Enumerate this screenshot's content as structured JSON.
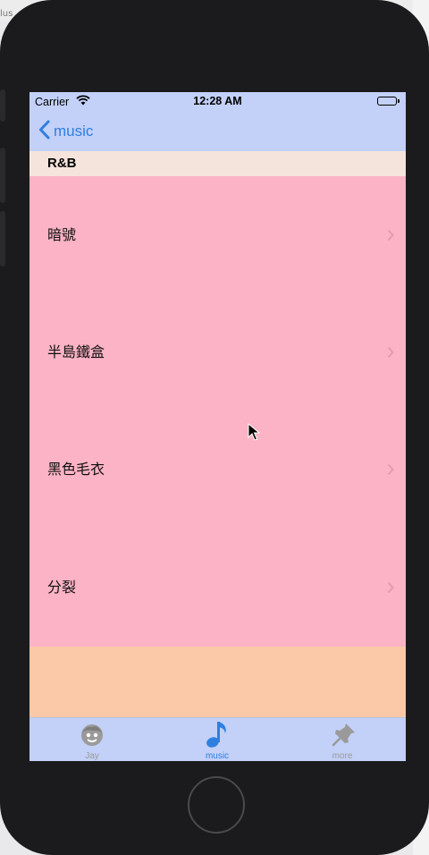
{
  "background": {
    "window_label": "lus"
  },
  "status_bar": {
    "carrier": "Carrier",
    "time": "12:28 AM"
  },
  "nav_bar": {
    "back_label": "music"
  },
  "section": {
    "header": "R&B"
  },
  "rows": [
    {
      "title": "暗號"
    },
    {
      "title": "半島鐵盒"
    },
    {
      "title": "黑色毛衣"
    },
    {
      "title": "分裂"
    }
  ],
  "tab_bar": {
    "tabs": [
      {
        "label": "Jay",
        "icon": "face-icon",
        "selected": false
      },
      {
        "label": "music",
        "icon": "music-note-icon",
        "selected": true
      },
      {
        "label": "more",
        "icon": "pin-icon",
        "selected": false
      }
    ]
  },
  "colors": {
    "bar": "#c3d0f7",
    "header": "#f5e4dc",
    "rows": "#fbb3c5",
    "footer": "#fbc8a8",
    "accent": "#2f7fe0",
    "inactive": "#9a9a9a"
  }
}
